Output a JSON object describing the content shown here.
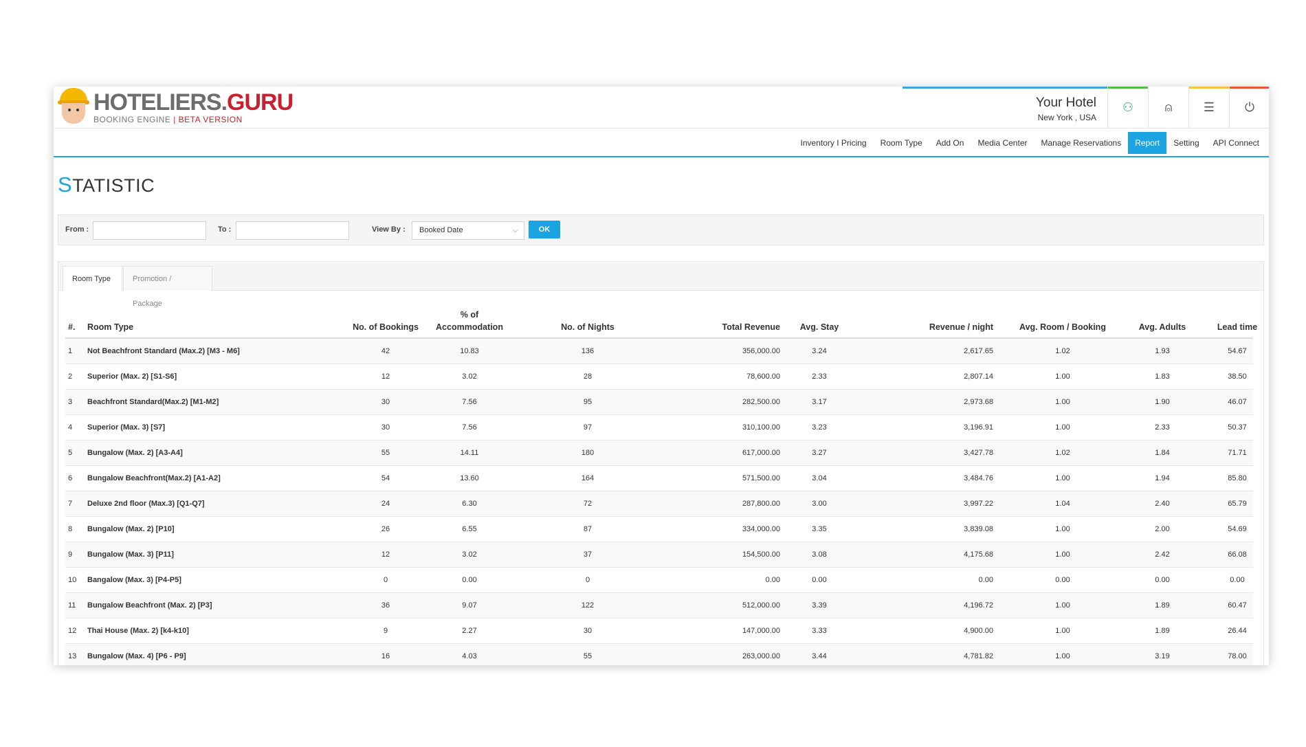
{
  "brand": {
    "name_part1": "HOTELIERS.",
    "name_part2": "GURU",
    "tagline_main": "BOOKING ENGINE",
    "tagline_sep": " | ",
    "tagline_beta": "BETA VERSION"
  },
  "hotel": {
    "name": "Your Hotel",
    "location": "New York , USA"
  },
  "header_icons": [
    {
      "icon": "handshake-icon",
      "glyph": "⚇",
      "color": "#2aaa8a",
      "bar": "#5ab94b"
    },
    {
      "icon": "bell-icon",
      "glyph": "⍝",
      "color": "#555555",
      "bar": "#ffffff"
    },
    {
      "icon": "list-icon",
      "glyph": "☰",
      "color": "#555555",
      "bar": "#f5c542"
    },
    {
      "icon": "power-icon",
      "glyph": "⏻",
      "color": "#555555",
      "bar": "#e8553a"
    }
  ],
  "nav": {
    "items": [
      "Inventory I Pricing",
      "Room Type",
      "Add On",
      "Media Center",
      "Manage Reservations",
      "Report",
      "Setting",
      "API Connect"
    ],
    "active": "Report"
  },
  "page": {
    "title_first": "S",
    "title_rest": "TATISTIC"
  },
  "filter": {
    "from_label": "From :",
    "to_label": "To :",
    "view_by_label": "View By :",
    "view_by_value": "Booked Date",
    "ok_label": "OK"
  },
  "tabs": [
    {
      "label": "Room Type",
      "active": true
    },
    {
      "label": "Promotion / Package",
      "active": false
    }
  ],
  "table": {
    "headers": {
      "num": "#.",
      "room_type": "Room Type",
      "bookings": "No. of Bookings",
      "accommodation_line1": "% of",
      "accommodation_line2": "Accommodation",
      "nights": "No. of Nights",
      "total_revenue": "Total Revenue",
      "avg_stay": "Avg. Stay",
      "revenue_per_night": "Revenue / night",
      "avg_room_booking": "Avg. Room / Booking",
      "avg_adults": "Avg. Adults",
      "lead_time": "Lead time"
    },
    "rows": [
      [
        "1",
        "Not Beachfront Standard (Max.2) [M3 - M6]",
        "42",
        "10.83",
        "136",
        "356,000.00",
        "3.24",
        "2,617.65",
        "1.02",
        "1.93",
        "54.67"
      ],
      [
        "2",
        "Superior (Max. 2) [S1-S6]",
        "12",
        "3.02",
        "28",
        "78,600.00",
        "2.33",
        "2,807.14",
        "1.00",
        "1.83",
        "38.50"
      ],
      [
        "3",
        "Beachfront Standard(Max.2) [M1-M2]",
        "30",
        "7.56",
        "95",
        "282,500.00",
        "3.17",
        "2,973.68",
        "1.00",
        "1.90",
        "46.07"
      ],
      [
        "4",
        "Superior (Max. 3) [S7]",
        "30",
        "7.56",
        "97",
        "310,100.00",
        "3.23",
        "3,196.91",
        "1.00",
        "2.33",
        "50.37"
      ],
      [
        "5",
        "Bungalow (Max. 2) [A3-A4]",
        "55",
        "14.11",
        "180",
        "617,000.00",
        "3.27",
        "3,427.78",
        "1.02",
        "1.84",
        "71.71"
      ],
      [
        "6",
        "Bungalow Beachfront(Max.2) [A1-A2]",
        "54",
        "13.60",
        "164",
        "571,500.00",
        "3.04",
        "3,484.76",
        "1.00",
        "1.94",
        "85.80"
      ],
      [
        "7",
        "Deluxe 2nd floor (Max.3) [Q1-Q7]",
        "24",
        "6.30",
        "72",
        "287,800.00",
        "3.00",
        "3,997.22",
        "1.04",
        "2.40",
        "65.79"
      ],
      [
        "8",
        "Bungalow (Max. 2) [P10]",
        "26",
        "6.55",
        "87",
        "334,000.00",
        "3.35",
        "3,839.08",
        "1.00",
        "2.00",
        "54.69"
      ],
      [
        "9",
        "Bungalow (Max. 3) [P11]",
        "12",
        "3.02",
        "37",
        "154,500.00",
        "3.08",
        "4,175.68",
        "1.00",
        "2.42",
        "66.08"
      ],
      [
        "10",
        "Bangalow (Max. 3) [P4-P5]",
        "0",
        "0.00",
        "0",
        "0.00",
        "0.00",
        "0.00",
        "0.00",
        "0.00",
        "0.00"
      ],
      [
        "11",
        "Bungalow Beachfront (Max. 2) [P3]",
        "36",
        "9.07",
        "122",
        "512,000.00",
        "3.39",
        "4,196.72",
        "1.00",
        "1.89",
        "60.47"
      ],
      [
        "12",
        "Thai House (Max. 2) [k4-k10]",
        "9",
        "2.27",
        "30",
        "147,000.00",
        "3.33",
        "4,900.00",
        "1.00",
        "1.89",
        "26.44"
      ],
      [
        "13",
        "Bungalow (Max. 4) [P6 - P9]",
        "16",
        "4.03",
        "55",
        "263,000.00",
        "3.44",
        "4,781.82",
        "1.00",
        "3.19",
        "78.00"
      ]
    ]
  }
}
